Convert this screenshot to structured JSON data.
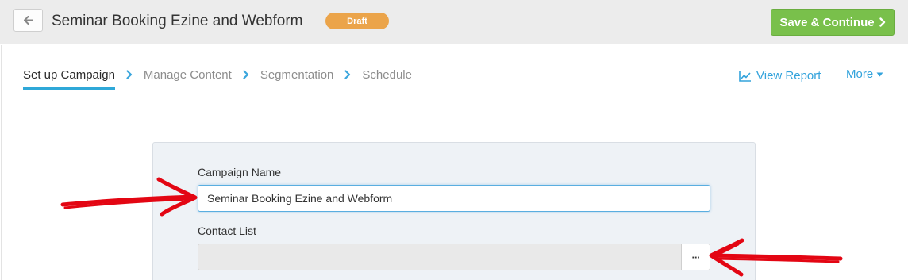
{
  "header": {
    "back_icon": "arrow-left-icon",
    "title": "Seminar Booking Ezine and Webform",
    "status": "Draft",
    "save_label": "Save & Continue",
    "save_icon": "chevron-right-icon"
  },
  "steps": [
    {
      "label": "Set up Campaign",
      "active": true
    },
    {
      "label": "Manage Content",
      "active": false
    },
    {
      "label": "Segmentation",
      "active": false
    },
    {
      "label": "Schedule",
      "active": false
    }
  ],
  "actions": {
    "view_report": "View Report",
    "view_report_icon": "line-chart-icon",
    "more": "More",
    "more_icon": "caret-down-icon"
  },
  "form": {
    "campaign_name_label": "Campaign Name",
    "campaign_name_value": "Seminar Booking Ezine and Webform",
    "contact_list_label": "Contact List",
    "contact_list_value": "",
    "contact_list_button": "···"
  },
  "colors": {
    "accent": "#33a3dc",
    "save_green": "#79c04b",
    "draft_orange": "#eba44a",
    "annotation_red": "#e30613"
  }
}
